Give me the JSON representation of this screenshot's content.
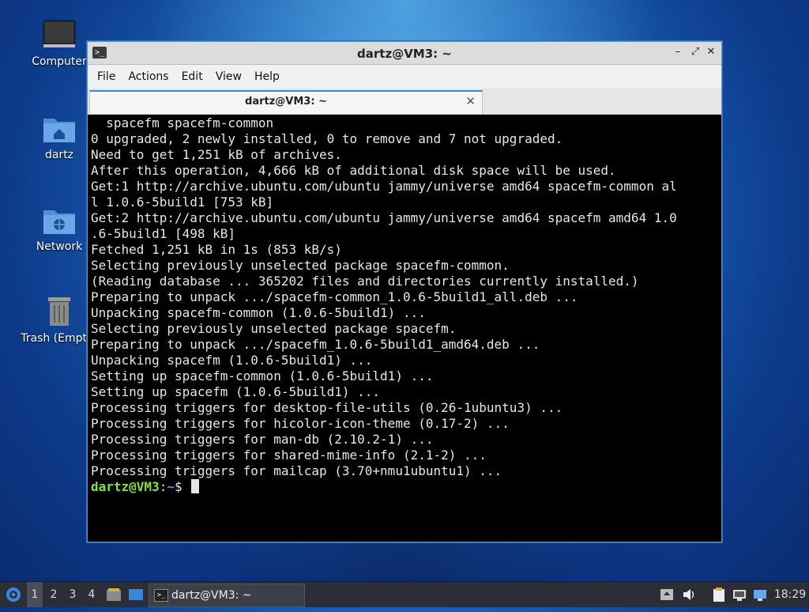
{
  "desktop": {
    "icons": [
      {
        "label": "Computer",
        "icon": "computer-icon"
      },
      {
        "label": "dartz",
        "icon": "home-folder-icon"
      },
      {
        "label": "Network",
        "icon": "network-folder-icon"
      },
      {
        "label": "Trash (Empty)",
        "icon": "trash-icon"
      }
    ]
  },
  "window": {
    "title": "dartz@VM3: ~",
    "menu": [
      "File",
      "Actions",
      "Edit",
      "View",
      "Help"
    ],
    "tab_label": "dartz@VM3: ~",
    "controls": {
      "minimize": "–",
      "maximize": "⤢",
      "close": "✕"
    }
  },
  "terminal": {
    "lines": [
      "  spacefm spacefm-common",
      "0 upgraded, 2 newly installed, 0 to remove and 7 not upgraded.",
      "Need to get 1,251 kB of archives.",
      "After this operation, 4,666 kB of additional disk space will be used.",
      "Get:1 http://archive.ubuntu.com/ubuntu jammy/universe amd64 spacefm-common al",
      "l 1.0.6-5build1 [753 kB]",
      "Get:2 http://archive.ubuntu.com/ubuntu jammy/universe amd64 spacefm amd64 1.0",
      ".6-5build1 [498 kB]",
      "Fetched 1,251 kB in 1s (853 kB/s)",
      "Selecting previously unselected package spacefm-common.",
      "(Reading database ... 365202 files and directories currently installed.)",
      "Preparing to unpack .../spacefm-common_1.0.6-5build1_all.deb ...",
      "Unpacking spacefm-common (1.0.6-5build1) ...",
      "Selecting previously unselected package spacefm.",
      "Preparing to unpack .../spacefm_1.0.6-5build1_amd64.deb ...",
      "Unpacking spacefm (1.0.6-5build1) ...",
      "Setting up spacefm-common (1.0.6-5build1) ...",
      "Setting up spacefm (1.0.6-5build1) ...",
      "Processing triggers for desktop-file-utils (0.26-1ubuntu3) ...",
      "Processing triggers for hicolor-icon-theme (0.17-2) ...",
      "Processing triggers for man-db (2.10.2-1) ...",
      "Processing triggers for shared-mime-info (2.1-2) ...",
      "Processing triggers for mailcap (3.70+nmu1ubuntu1) ..."
    ],
    "prompt_user": "dartz@VM3",
    "prompt_sep": ":",
    "prompt_path": "~",
    "prompt_symbol": "$ "
  },
  "taskbar": {
    "workspaces": [
      "1",
      "2",
      "3",
      "4"
    ],
    "active_workspace": "1",
    "task_label": "dartz@VM3: ~",
    "clock": "18:29"
  }
}
